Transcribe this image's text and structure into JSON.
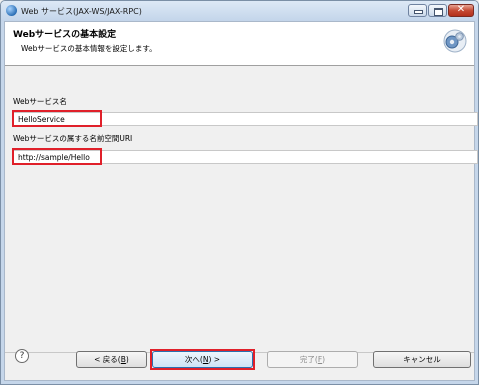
{
  "window": {
    "title": "Web サービス(JAX-WS/JAX-RPC)",
    "min_symbol": "",
    "max_symbol": "",
    "close_symbol": "✕"
  },
  "header": {
    "title": "Webサービスの基本設定",
    "description": "Webサービスの基本情報を設定します。"
  },
  "form": {
    "service_name_label": "Webサービス名",
    "service_name_value": "HelloService",
    "namespace_label": "Webサービスの属する名前空間URI",
    "namespace_value": "http://sample/Hello"
  },
  "footer": {
    "help_symbol": "?",
    "back": {
      "text": "< 戻る(",
      "mnemonic": "B",
      "suffix": ")"
    },
    "next": {
      "text": "次へ(",
      "mnemonic": "N",
      "suffix": ") >"
    },
    "finish": {
      "text": "完了(",
      "mnemonic": "F",
      "suffix": ")"
    },
    "cancel": "キャンセル"
  },
  "colors": {
    "highlight": "#e0202a",
    "title_bar": "#c5d6ea",
    "close_button": "#c54a34"
  }
}
